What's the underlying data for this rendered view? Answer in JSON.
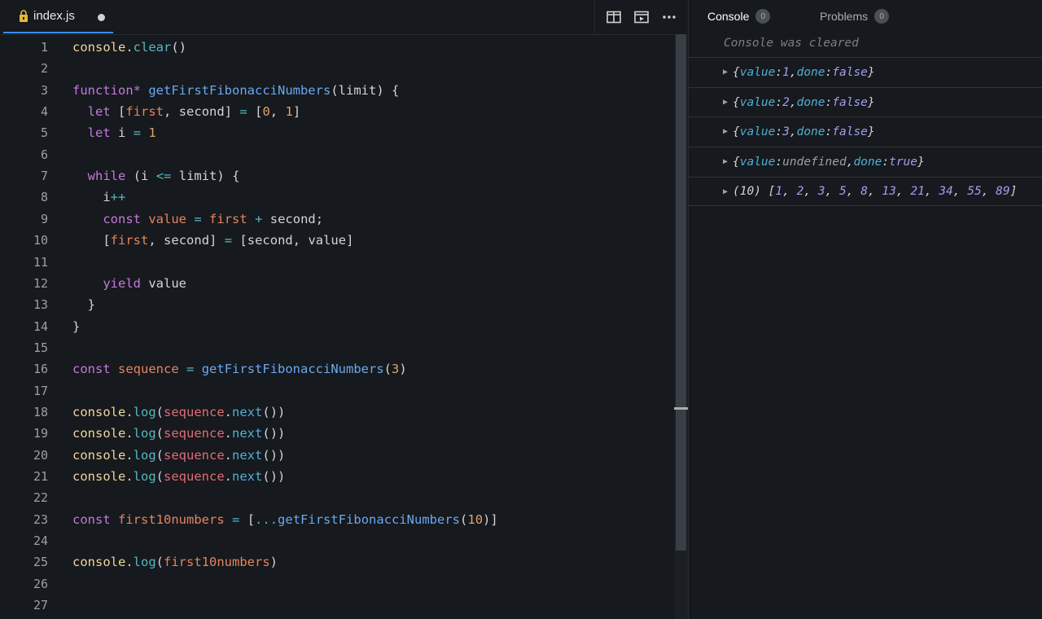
{
  "editor": {
    "tab": {
      "filename": "index.js",
      "icon": "javascript-file-icon",
      "unsaved": true
    },
    "toolbar": [
      "split-editor-icon",
      "preview-icon",
      "more-options-icon"
    ],
    "lines": [
      "console.clear()",
      "",
      "function* getFirstFibonacciNumbers(limit) {",
      "  let [first, second] = [0, 1]",
      "  let i = 1",
      "",
      "  while (i <= limit) {",
      "    i++",
      "    const value = first + second;",
      "    [first, second] = [second, value]",
      "",
      "    yield value",
      "  }",
      "}",
      "",
      "const sequence = getFirstFibonacciNumbers(3)",
      "",
      "console.log(sequence.next())",
      "console.log(sequence.next())",
      "console.log(sequence.next())",
      "console.log(sequence.next())",
      "",
      "const first10numbers = [...getFirstFibonacciNumbers(10)]",
      "",
      "console.log(first10numbers)",
      "",
      ""
    ]
  },
  "console": {
    "tabs": [
      {
        "label": "Console",
        "count": "0",
        "active": true
      },
      {
        "label": "Problems",
        "count": "0",
        "active": false
      }
    ],
    "cleared_message": "Console was cleared",
    "entries": [
      {
        "value": "1",
        "done": "false"
      },
      {
        "value": "2",
        "done": "false"
      },
      {
        "value": "3",
        "done": "false"
      },
      {
        "value": "undefined",
        "done": "true"
      }
    ],
    "array_entry": {
      "length_label": "(10)",
      "items": [
        "1",
        "2",
        "3",
        "5",
        "8",
        "13",
        "21",
        "34",
        "55",
        "89"
      ]
    }
  }
}
